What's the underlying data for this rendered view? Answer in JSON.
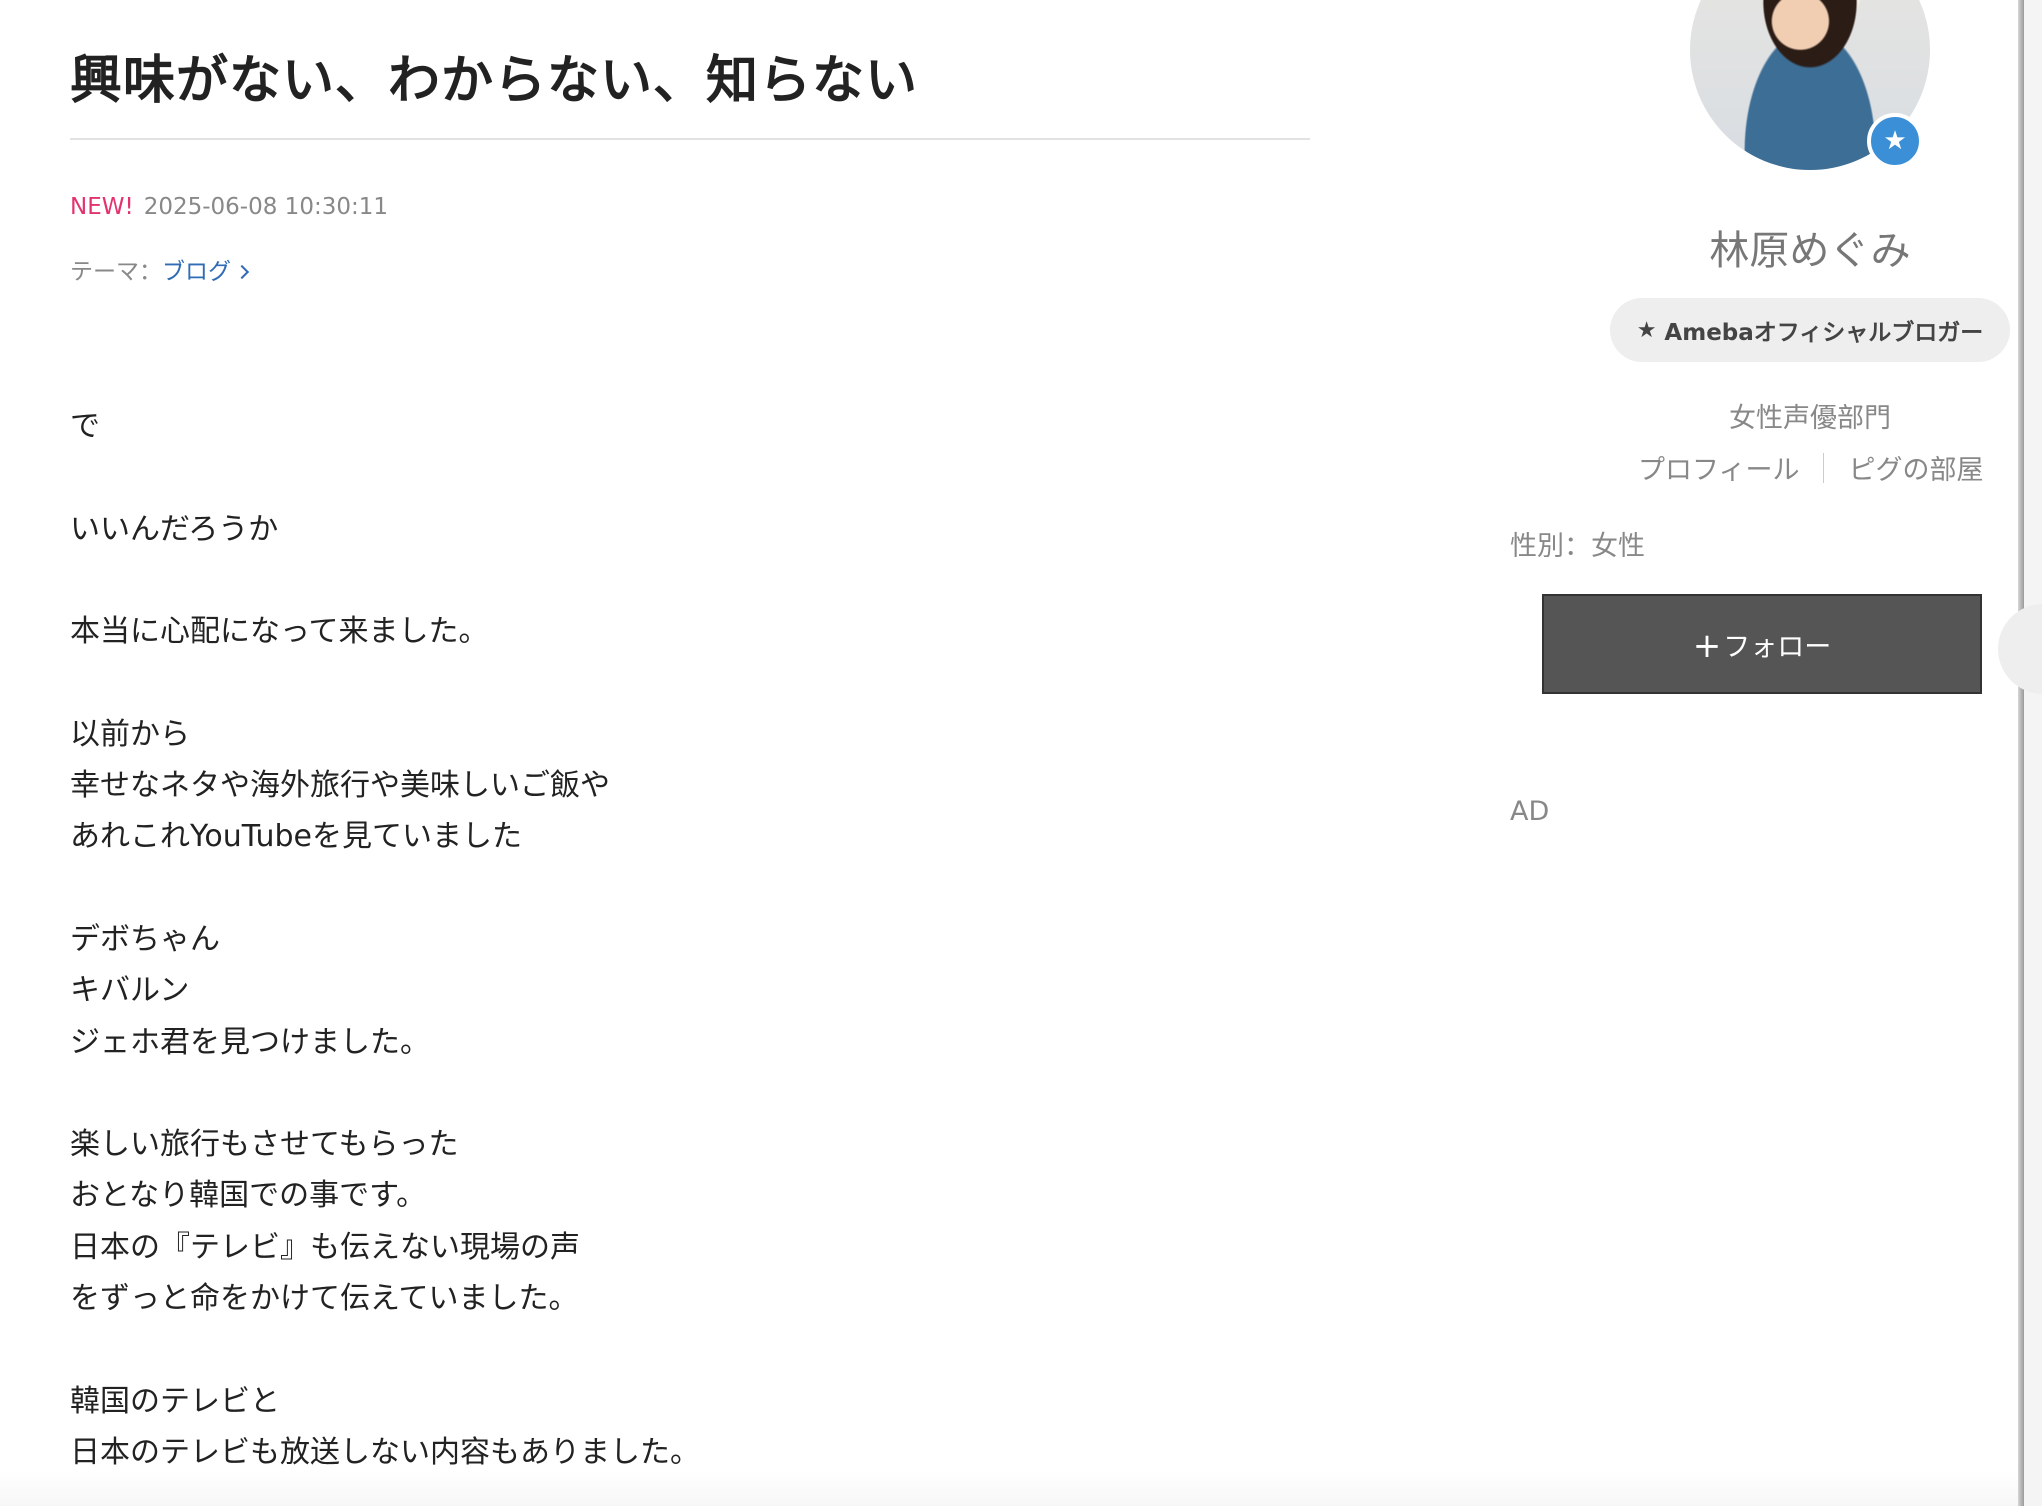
{
  "article": {
    "title": "興味がない、わからない、知らない",
    "new_badge": "NEW!",
    "date": "2025-06-08 10:30:11",
    "theme_label": "テーマ：",
    "theme_link": "ブログ",
    "body": [
      "で",
      "",
      "いいんだろうか",
      "",
      "本当に心配になって来ました。",
      "",
      "以前から",
      "幸せなネタや海外旅行や美味しいご飯や",
      "あれこれYouTubeを見ていました",
      "",
      "デボちゃん",
      "キバルン",
      "ジェホ君を見つけました。",
      "",
      "楽しい旅行もさせてもらった",
      "おとなり韓国での事です。",
      "日本の『テレビ』も伝えない現場の声",
      "をずっと命をかけて伝えていました。",
      "",
      "韓国のテレビと",
      "日本のテレビも放送しない内容もありました。"
    ]
  },
  "sidebar": {
    "blogger_name": "林原めぐみ",
    "official_label": "Amebaオフィシャルブロガー",
    "official_icon": "shooting-star-icon",
    "genre": "女性声優部門",
    "profile_link": "プロフィール",
    "room_link": "ピグの部屋",
    "gender": "性別：女性",
    "follow_plus": "+",
    "follow_label": "フォロー",
    "ad_label": "AD"
  },
  "colors": {
    "new_badge": "#e3336f",
    "link": "#2f6cb5",
    "follow_button_bg": "#555555",
    "official_badge": "#3a8fd6",
    "pill_bg": "#eeeeee"
  }
}
